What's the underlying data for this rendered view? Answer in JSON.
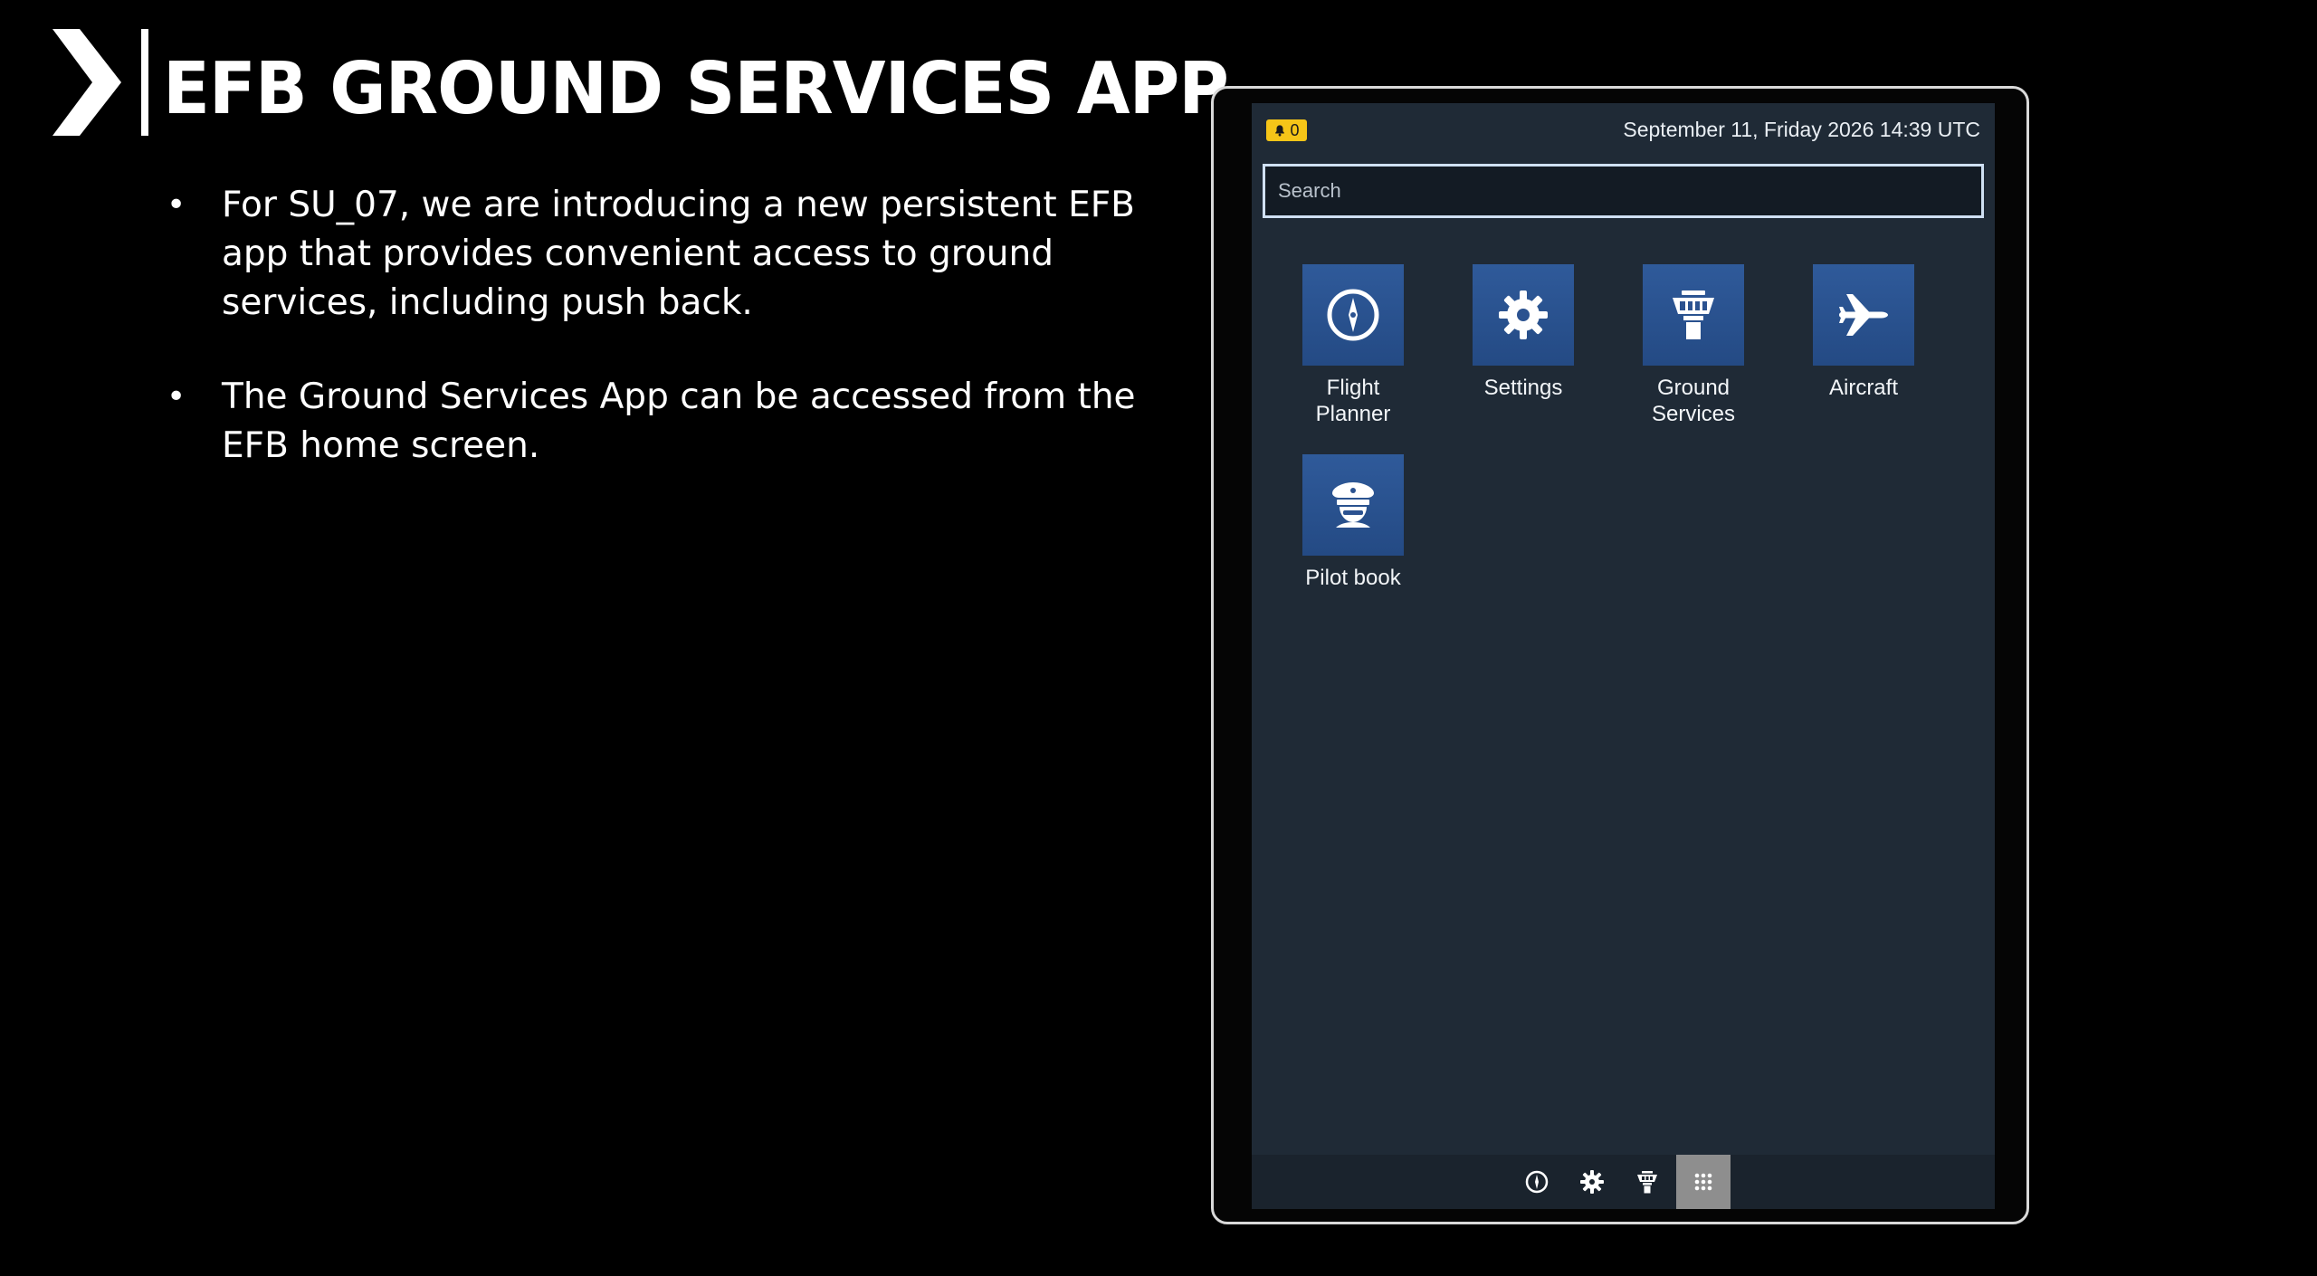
{
  "slide": {
    "title": "EFB GROUND SERVICES APP",
    "bullets": [
      "For SU_07, we are introducing a new persistent EFB app that provides convenient access to ground services, including push back.",
      "The Ground Services App can be accessed from the EFB home screen."
    ]
  },
  "efb": {
    "status": {
      "notification_count": "0",
      "datetime": "September 11, Friday 2026 14:39 UTC"
    },
    "search": {
      "placeholder": "Search"
    },
    "apps": [
      {
        "label": "Flight\nPlanner",
        "icon": "compass-icon"
      },
      {
        "label": "Settings",
        "icon": "gear-icon"
      },
      {
        "label": "Ground\nServices",
        "icon": "control-tower-icon"
      },
      {
        "label": "Aircraft",
        "icon": "airplane-icon"
      },
      {
        "label": "Pilot book",
        "icon": "pilot-cap-icon"
      }
    ],
    "dock": [
      {
        "icon": "compass-icon"
      },
      {
        "icon": "gear-icon"
      },
      {
        "icon": "control-tower-icon"
      },
      {
        "icon": "app-grid-icon",
        "active": true
      }
    ]
  },
  "colors": {
    "background": "#000000",
    "screen": "#1f2a36",
    "app_tile": "#2b5290",
    "notification": "#f5c518",
    "search_border": "#cfe0f3",
    "dock_active": "#8e8e8e"
  }
}
